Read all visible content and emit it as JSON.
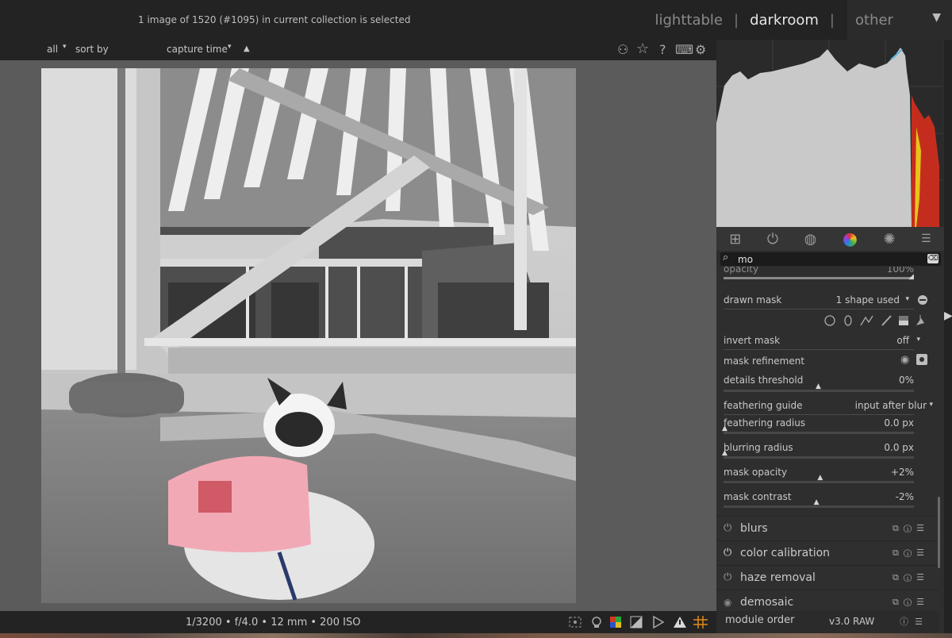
{
  "header": {
    "status": "1 image of 1520 (#1095) in current collection is selected",
    "views": {
      "lighttable": "lighttable",
      "darkroom": "darkroom",
      "other": "other",
      "separator": "|"
    }
  },
  "filter": {
    "collection": "all",
    "sort_by_label": "sort by",
    "sort_field": "capture time",
    "caret": "▾",
    "ascending": "▲"
  },
  "top_icons": {
    "styles": "⚇",
    "star": "☆",
    "help": "?",
    "keyboard": "⌨",
    "settings": "⚙"
  },
  "bottom": {
    "exif": "1/3200 • f/4.0 • 12 mm • 200 ISO",
    "module_order_label": "module order",
    "module_order_value": "v3.0 RAW"
  },
  "search": {
    "value": "mo",
    "icon": "⌕",
    "clear": "⌫"
  },
  "module_tabs": {
    "quick": "⊞",
    "active": "⏻",
    "base": "◍",
    "color": "●",
    "effects": "✺",
    "menu": "☰"
  },
  "mask": {
    "opacity_label": "opacity",
    "opacity_value": "100%",
    "drawn_mask_label": "drawn mask",
    "drawn_mask_value": "1 shape used",
    "drawn_mask_caret": "▾",
    "invert_mask_label": "invert mask",
    "invert_mask_value": "off",
    "refinement_label": "mask refinement",
    "details_label": "details threshold",
    "details_value": "0%",
    "details_level": 0.5,
    "feather_guide_label": "feathering guide",
    "feather_guide_value": "input after blur",
    "feather_radius_label": "feathering radius",
    "feather_radius_value": "0.0 px",
    "feather_radius_level": 0,
    "blur_radius_label": "blurring radius",
    "blur_radius_value": "0.0 px",
    "blur_radius_level": 0,
    "mask_opacity_label": "mask opacity",
    "mask_opacity_value": "+2%",
    "mask_opacity_level": 0.51,
    "mask_contrast_label": "mask contrast",
    "mask_contrast_value": "-2%",
    "mask_contrast_level": 0.49
  },
  "modules": [
    {
      "name": "blurs"
    },
    {
      "name": "color calibration"
    },
    {
      "name": "haze removal"
    },
    {
      "name": "demosaic"
    }
  ],
  "colors": {
    "accent_red": "#d23a1e",
    "panel_bg": "#2c2c2c",
    "center_bg": "#5b5b5b"
  }
}
